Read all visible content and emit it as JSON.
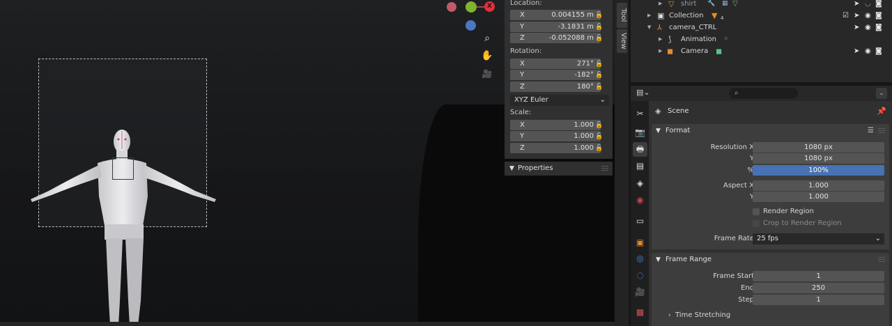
{
  "viewport": {
    "gizmo": {
      "x_label": "X"
    },
    "tools": [
      {
        "name": "zoom",
        "glyph": "⌕"
      },
      {
        "name": "pan",
        "glyph": "✋"
      },
      {
        "name": "camera",
        "glyph": "🎥"
      }
    ]
  },
  "npanel": {
    "location_label": "Location:",
    "location": [
      {
        "axis": "X",
        "value": "0.004155 m"
      },
      {
        "axis": "Y",
        "value": "-3.1831 m"
      },
      {
        "axis": "Z",
        "value": "-0.052088 m"
      }
    ],
    "rotation_label": "Rotation:",
    "rotation": [
      {
        "axis": "X",
        "value": "271°"
      },
      {
        "axis": "Y",
        "value": "-182°"
      },
      {
        "axis": "Z",
        "value": "180°"
      }
    ],
    "rotation_mode": "XYZ Euler",
    "scale_label": "Scale:",
    "scale": [
      {
        "axis": "X",
        "value": "1.000"
      },
      {
        "axis": "Y",
        "value": "1.000"
      },
      {
        "axis": "Z",
        "value": "1.000"
      }
    ],
    "properties_header": "Properties",
    "tabs": {
      "tool": "Tool",
      "view": "View"
    }
  },
  "outliner": {
    "rows": [
      {
        "label": "shirt"
      },
      {
        "label": "Collection",
        "badge": "4"
      },
      {
        "label": "camera_CTRL"
      },
      {
        "label": "Animation"
      },
      {
        "label": "Camera"
      }
    ]
  },
  "properties": {
    "scene_label": "Scene",
    "format": {
      "header": "Format",
      "resolution_x_label": "Resolution X",
      "resolution_x": "1080 px",
      "resolution_y_label": "Y",
      "resolution_y": "1080 px",
      "percent_label": "%",
      "percent": "100%",
      "aspect_x_label": "Aspect X",
      "aspect_x": "1.000",
      "aspect_y_label": "Y",
      "aspect_y": "1.000",
      "render_region": "Render Region",
      "crop_region": "Crop to Render Region",
      "frame_rate_label": "Frame Rate",
      "frame_rate": "25 fps"
    },
    "frame_range": {
      "header": "Frame Range",
      "start_label": "Frame Start",
      "start": "1",
      "end_label": "End",
      "end": "250",
      "step_label": "Step",
      "step": "1",
      "time_stretching": "Time Stretching"
    }
  }
}
